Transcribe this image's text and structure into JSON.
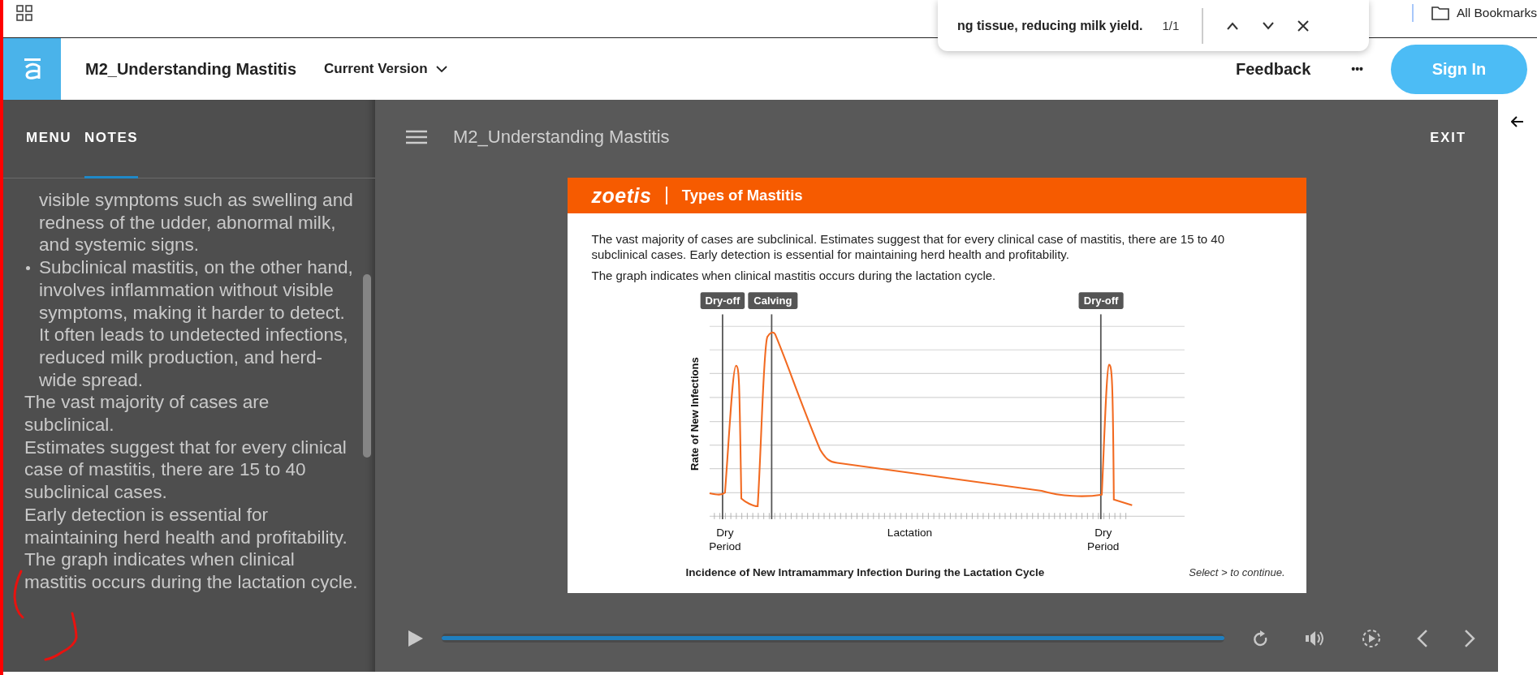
{
  "browser": {
    "bookmarks_label": "All Bookmarks"
  },
  "find_bar": {
    "query": "ng tissue, reducing milk yield.",
    "count": "1/1"
  },
  "header": {
    "course_title": "M2_Understanding Mastitis",
    "version_menu": "Current Version",
    "feedback": "Feedback",
    "more": "•••",
    "sign_in": "Sign In"
  },
  "sidebar": {
    "tabs": [
      {
        "label": "MENU",
        "selected": false
      },
      {
        "label": "NOTES",
        "selected": true
      }
    ],
    "notes": [
      {
        "kind": "continuation",
        "text": "visible symptoms such as swelling and redness of the udder, abnormal milk, and systemic signs."
      },
      {
        "kind": "bullet",
        "text": "Subclinical mastitis, on the other hand, involves inflammation without visible symptoms, making it harder to detect. It often leads to undetected infections, reduced milk production, and herd-wide spread."
      },
      {
        "kind": "paragraph",
        "text": "The vast majority of cases are subclinical."
      },
      {
        "kind": "paragraph",
        "text": "Estimates suggest that for every clinical case of mastitis, there are 15 to 40 subclinical cases."
      },
      {
        "kind": "paragraph",
        "text": "Early detection is essential for maintaining herd health and profitability."
      },
      {
        "kind": "paragraph",
        "text": "The graph indicates when clinical mastitis occurs during the lactation cycle."
      }
    ]
  },
  "player": {
    "title": "M2_Understanding Mastitis",
    "exit": "EXIT",
    "progress": {
      "level": 1
    }
  },
  "slide": {
    "brand": "zoetis",
    "title": "Types of Mastitis",
    "paragraphs": [
      "The vast majority of cases are subclinical. Estimates suggest that for every clinical case of mastitis, there are 15 to 40 subclinical cases. Early detection is essential for maintaining herd health and profitability.",
      "The graph indicates when clinical mastitis occurs during the lactation cycle."
    ],
    "chart": {
      "markers": [
        "Dry-off",
        "Calving",
        "Dry-off"
      ],
      "ylabel": "Rate of New Infections",
      "xlabels": [
        "Dry Period",
        "Lactation",
        "Dry Period"
      ],
      "caption": "Incidence of New Intramammary Infection During the Lactation Cycle"
    },
    "hint": "Select > to continue."
  }
}
